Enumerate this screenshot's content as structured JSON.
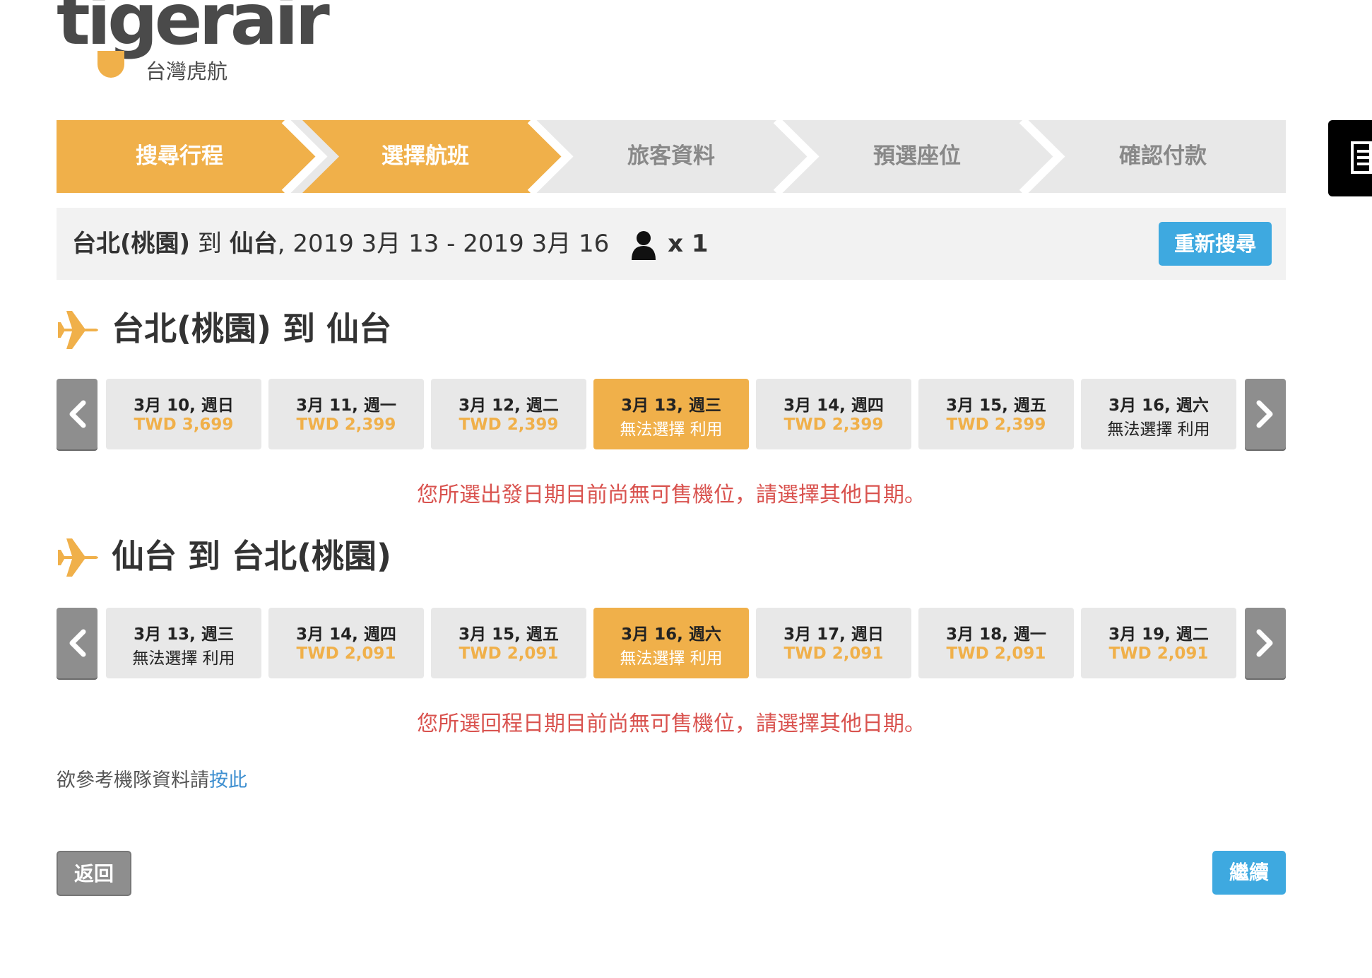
{
  "brand": {
    "name": "tigerair",
    "subtitle": "台灣虎航",
    "accent": "#f0b04a",
    "blue": "#3ea9e0",
    "error": "#d9534f"
  },
  "steps": [
    {
      "label": "搜尋行程",
      "state": "done"
    },
    {
      "label": "選擇航班",
      "state": "current"
    },
    {
      "label": "旅客資料",
      "state": "todo"
    },
    {
      "label": "預選座位",
      "state": "todo"
    },
    {
      "label": "確認付款",
      "state": "todo"
    }
  ],
  "summary": {
    "origin": "台北(桃園)",
    "to_word": "到",
    "destination": "仙台",
    "dates": ", 2019 3月 13 - 2019 3月 16",
    "passengers": "x 1",
    "research_label": "重新搜尋"
  },
  "outbound": {
    "title": "台北(桃園) 到 仙台",
    "dates": [
      {
        "date": "3月 10, 週日",
        "price": "TWD 3,699"
      },
      {
        "date": "3月 11, 週一",
        "price": "TWD 2,399"
      },
      {
        "date": "3月 12, 週二",
        "price": "TWD 2,399"
      },
      {
        "date": "3月 13, 週三",
        "price": "無法選擇 利用"
      },
      {
        "date": "3月 14, 週四",
        "price": "TWD 2,399"
      },
      {
        "date": "3月 15, 週五",
        "price": "TWD 2,399"
      },
      {
        "date": "3月 16, 週六",
        "price": "無法選擇 利用"
      }
    ],
    "message": "您所選出發日期目前尚無可售機位，請選擇其他日期。"
  },
  "inbound": {
    "title": "仙台 到 台北(桃園)",
    "dates": [
      {
        "date": "3月 13, 週三",
        "price": "無法選擇 利用"
      },
      {
        "date": "3月 14, 週四",
        "price": "TWD 2,091"
      },
      {
        "date": "3月 15, 週五",
        "price": "TWD 2,091"
      },
      {
        "date": "3月 16, 週六",
        "price": "無法選擇 利用"
      },
      {
        "date": "3月 17, 週日",
        "price": "TWD 2,091"
      },
      {
        "date": "3月 18, 週一",
        "price": "TWD 2,091"
      },
      {
        "date": "3月 19, 週二",
        "price": "TWD 2,091"
      }
    ],
    "message": "您所選回程日期目前尚無可售機位，請選擇其他日期。"
  },
  "fleet": {
    "text": "欲參考機隊資料請",
    "link": "按此"
  },
  "footer": {
    "back_label": "返回",
    "continue_label": "繼續"
  }
}
